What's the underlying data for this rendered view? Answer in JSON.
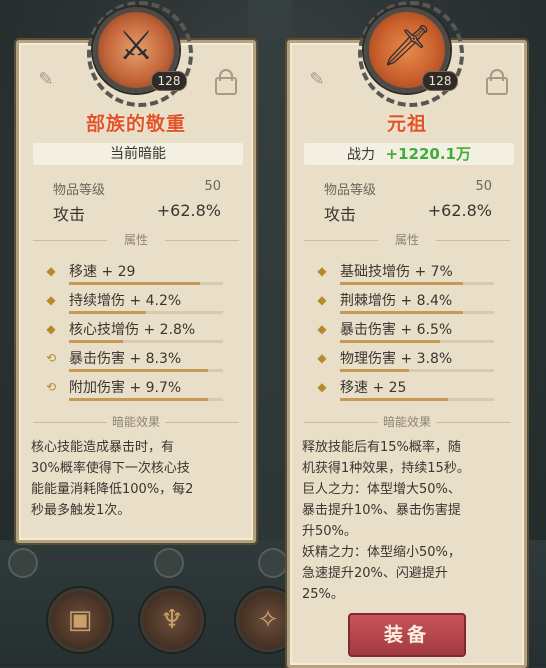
{
  "left_card": {
    "level": "128",
    "name": "部族的敬重",
    "band_label": "当前暗能",
    "item_level_label": "物品等级",
    "item_level_value": "50",
    "attack_label": "攻击",
    "attack_value": "+62.8%",
    "attr_header": "属性",
    "attributes": [
      {
        "text": "移速 + 29",
        "icon": "diamond-icon",
        "fill": 0.85
      },
      {
        "text": "持续增伤 + 4.2%",
        "icon": "diamond-icon",
        "fill": 0.5
      },
      {
        "text": "核心技增伤 + 2.8%",
        "icon": "diamond-icon",
        "fill": 0.35
      },
      {
        "text": "暴击伤害 + 8.3%",
        "icon": "reroll-icon",
        "fill": 0.9
      },
      {
        "text": "附加伤害 + 9.7%",
        "icon": "reroll-icon",
        "fill": 0.9
      }
    ],
    "effect_header": "暗能效果",
    "effect_lines": [
      "核心技能造成暴击时，有",
      "30%概率使得下一次核心技",
      "能能量消耗降低100%，每2",
      "秒最多触发1次。"
    ]
  },
  "right_card": {
    "level": "128",
    "name": "元祖",
    "power_label": "战力",
    "power_value": "+1220.1万",
    "item_level_label": "物品等级",
    "item_level_value": "50",
    "attack_label": "攻击",
    "attack_value": "+62.8%",
    "attr_header": "属性",
    "attributes": [
      {
        "text": "基础技增伤 + 7%",
        "icon": "diamond-icon",
        "fill": 0.8
      },
      {
        "text": "荆棘增伤 + 8.4%",
        "icon": "diamond-icon",
        "fill": 0.8
      },
      {
        "text": "暴击伤害 + 6.5%",
        "icon": "diamond-icon",
        "fill": 0.65
      },
      {
        "text": "物理伤害 + 3.8%",
        "icon": "diamond-icon",
        "fill": 0.45
      },
      {
        "text": "移速 + 25",
        "icon": "diamond-icon",
        "fill": 0.7
      }
    ],
    "effect_header": "暗能效果",
    "effect_lines": [
      "释放技能后有15%概率，随",
      "机获得1种效果，持续15秒。",
      "巨人之力：体型增大50%、",
      "暴击提升10%、暴击伤害提",
      "升50%。",
      "妖精之力：体型缩小50%，",
      "急速提升20%、闪避提升",
      "25%。"
    ],
    "equip_label": "装备"
  }
}
